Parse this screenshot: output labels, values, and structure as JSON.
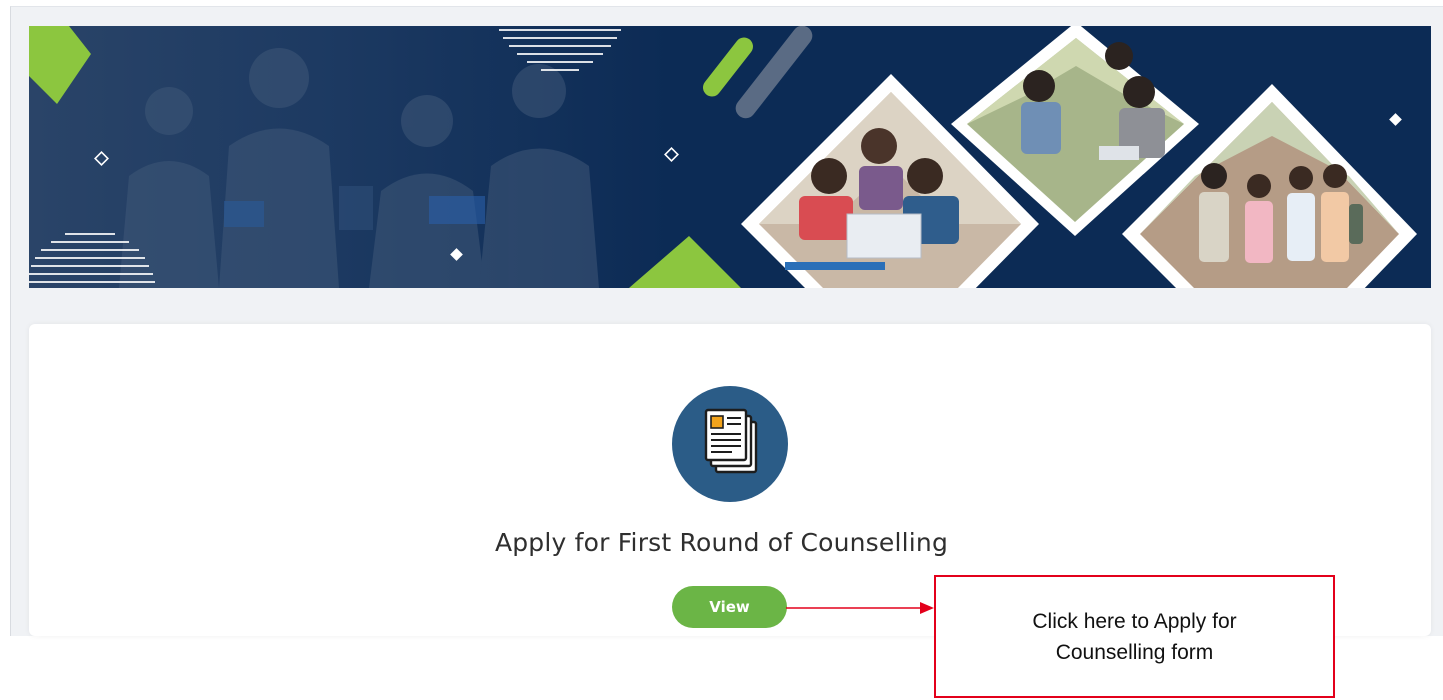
{
  "banner": {
    "image_name": "students-banner",
    "colors": {
      "navy": "#0c2b55",
      "accent_green": "#8cc63f",
      "white": "#ffffff"
    }
  },
  "card": {
    "icon": "document-icon",
    "title": "Apply for First Round of Counselling",
    "view_button_label": "View",
    "colors": {
      "badge": "#2b5c87",
      "button": "#6bb546"
    }
  },
  "annotation": {
    "callout_text": "Click here to Apply for Counselling form",
    "colors": {
      "border": "#e3001b",
      "arrow": "#e3001b"
    }
  }
}
